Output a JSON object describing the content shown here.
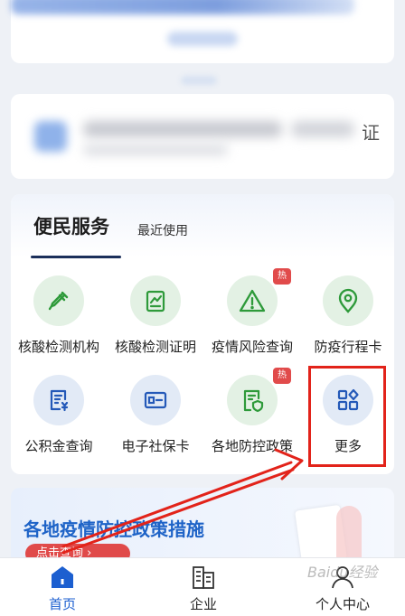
{
  "top_card": {},
  "info_card": {
    "cut_char": "证"
  },
  "services": {
    "tab_main": "便民服务",
    "tab_recent": "最近使用",
    "items": [
      {
        "label": "核酸检测机构",
        "icon": "dropper-icon",
        "color": "green",
        "hot": false
      },
      {
        "label": "核酸检测证明",
        "icon": "certificate-icon",
        "color": "green",
        "hot": false
      },
      {
        "label": "疫情风险查询",
        "icon": "warning-icon",
        "color": "green",
        "hot": true,
        "hot_label": "热"
      },
      {
        "label": "防疫行程卡",
        "icon": "location-pin-icon",
        "color": "green",
        "hot": false
      },
      {
        "label": "公积金查询",
        "icon": "document-yen-icon",
        "color": "blue",
        "hot": false
      },
      {
        "label": "电子社保卡",
        "icon": "id-card-icon",
        "color": "blue",
        "hot": false
      },
      {
        "label": "各地防控政策",
        "icon": "shield-doc-icon",
        "color": "green",
        "hot": true,
        "hot_label": "热"
      },
      {
        "label": "更多",
        "icon": "grid-more-icon",
        "color": "blue",
        "hot": false
      }
    ]
  },
  "banner": {
    "title": "各地疫情防控政策措施",
    "button": "点击查询 ›"
  },
  "tabbar": {
    "items": [
      {
        "label": "首页",
        "icon": "home-icon",
        "active": true
      },
      {
        "label": "企业",
        "icon": "building-icon",
        "active": false
      },
      {
        "label": "个人中心",
        "icon": "user-icon",
        "active": false
      }
    ]
  },
  "watermark": "Baidu经验",
  "colors": {
    "accent": "#1c5fd0",
    "green_icon": "#2e9a3a",
    "blue_icon": "#2459b8",
    "highlight": "#e2231a"
  }
}
